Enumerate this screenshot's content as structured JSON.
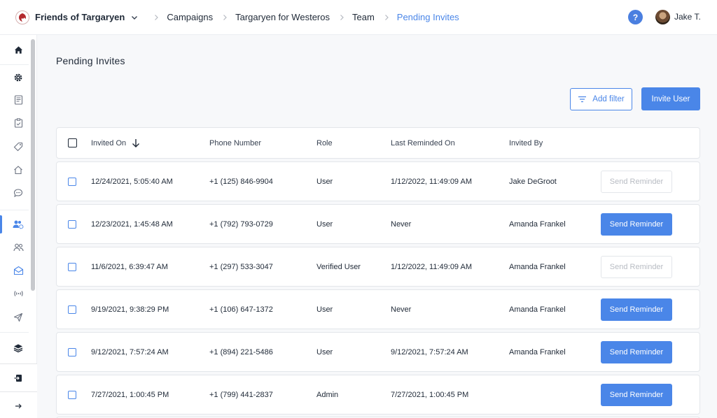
{
  "header": {
    "org_name": "Friends of Targaryen",
    "breadcrumbs": [
      "Campaigns",
      "Targaryen for Westeros",
      "Team",
      "Pending Invites"
    ],
    "help_label": "?",
    "user_name": "Jake T."
  },
  "sidebar": {
    "items": [
      {
        "name": "home-icon"
      },
      {
        "name": "gear-icon"
      },
      {
        "name": "document-icon"
      },
      {
        "name": "clipboard-icon"
      },
      {
        "name": "tag-icon"
      },
      {
        "name": "house-outline-icon"
      },
      {
        "name": "chat-icon"
      },
      {
        "name": "team-settings-icon",
        "active": true
      },
      {
        "name": "users-icon"
      },
      {
        "name": "mail-icon"
      },
      {
        "name": "broadcast-icon"
      },
      {
        "name": "send-icon"
      },
      {
        "name": "layers-icon"
      }
    ],
    "bottom": [
      {
        "name": "logout-icon"
      },
      {
        "name": "expand-arrow-icon"
      }
    ]
  },
  "main": {
    "title": "Pending Invites",
    "add_filter_label": "Add filter",
    "invite_user_label": "Invite User"
  },
  "table": {
    "columns": [
      "Invited On",
      "Phone Number",
      "Role",
      "Last Reminded On",
      "Invited By"
    ],
    "rows": [
      {
        "invited_on": "12/24/2021, 5:05:40 AM",
        "phone": "+1 (125) 846-9904",
        "role": "User",
        "last_reminded": "1/12/2022, 11:49:09 AM",
        "invited_by": "Jake DeGroot",
        "action": "Send Reminder",
        "action_enabled": false
      },
      {
        "invited_on": "12/23/2021, 1:45:48 AM",
        "phone": "+1 (792) 793-0729",
        "role": "User",
        "last_reminded": "Never",
        "invited_by": "Amanda Frankel",
        "action": "Send Reminder",
        "action_enabled": true
      },
      {
        "invited_on": "11/6/2021, 6:39:47 AM",
        "phone": "+1 (297) 533-3047",
        "role": "Verified User",
        "last_reminded": "1/12/2022, 11:49:09 AM",
        "invited_by": "Amanda Frankel",
        "action": "Send Reminder",
        "action_enabled": false
      },
      {
        "invited_on": "9/19/2021, 9:38:29 PM",
        "phone": "+1 (106) 647-1372",
        "role": "User",
        "last_reminded": "Never",
        "invited_by": "Amanda Frankel",
        "action": "Send Reminder",
        "action_enabled": true
      },
      {
        "invited_on": "9/12/2021, 7:57:24 AM",
        "phone": "+1 (894) 221-5486",
        "role": "User",
        "last_reminded": "9/12/2021, 7:57:24 AM",
        "invited_by": "Amanda Frankel",
        "action": "Send Reminder",
        "action_enabled": true
      },
      {
        "invited_on": "7/27/2021, 1:00:45 PM",
        "phone": "+1 (799) 441-2837",
        "role": "Admin",
        "last_reminded": "7/27/2021, 1:00:45 PM",
        "invited_by": "",
        "action": "Send Reminder",
        "action_enabled": true
      }
    ]
  },
  "colors": {
    "accent": "#4a86e8",
    "disabled_text": "#b8bcc3",
    "background": "#f7f8fa"
  }
}
